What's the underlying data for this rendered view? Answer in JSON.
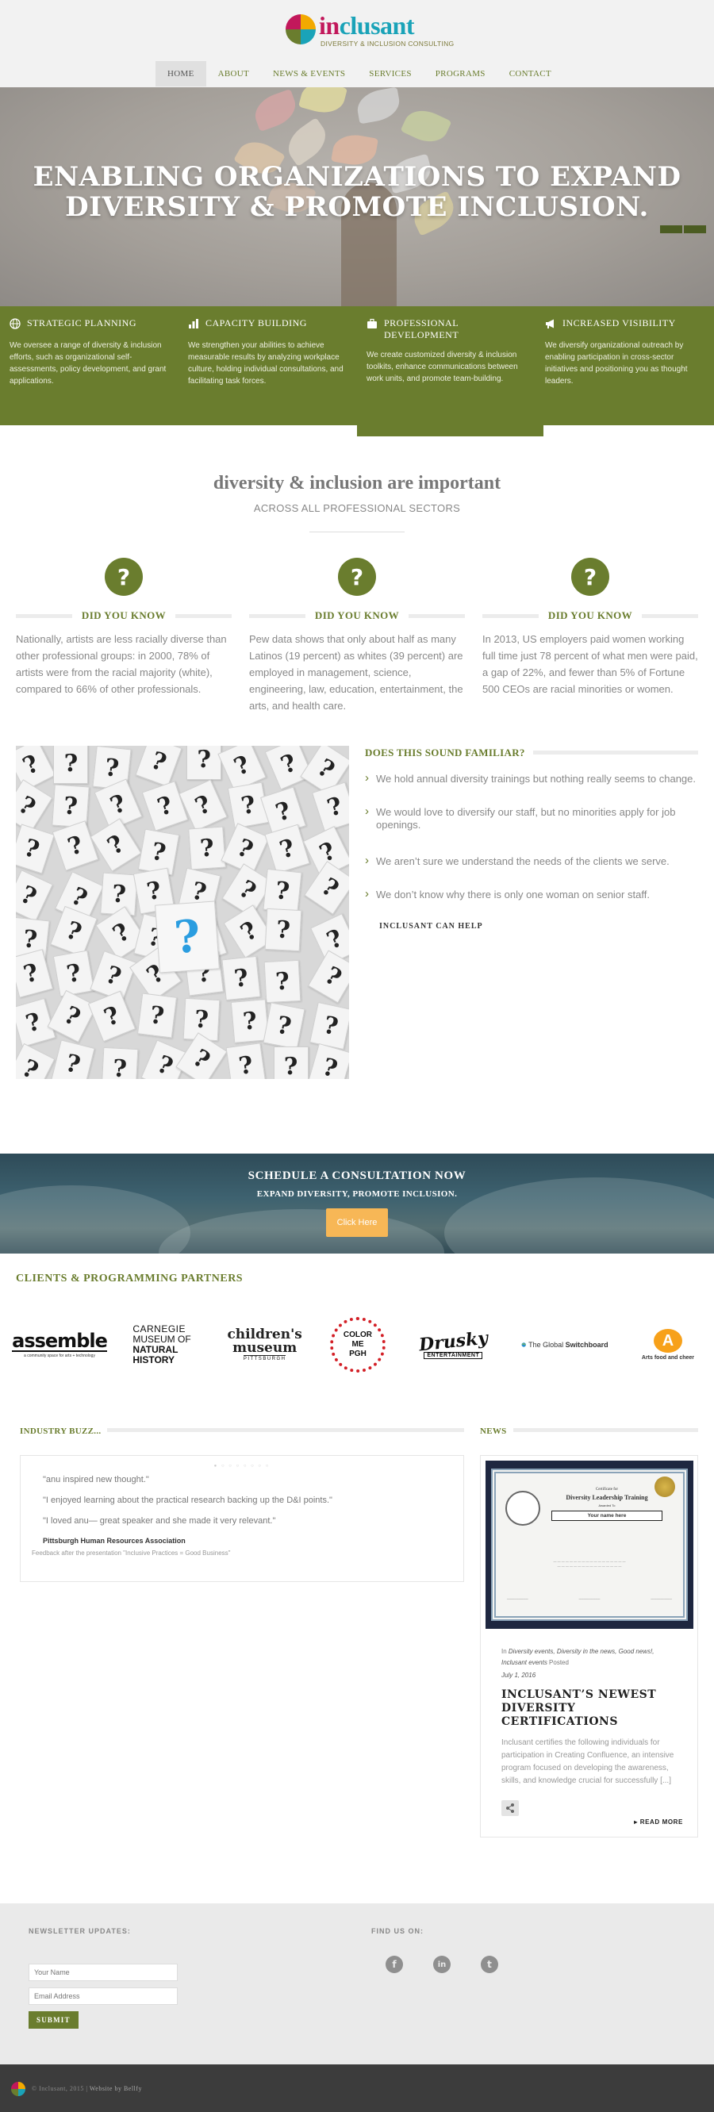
{
  "brand": {
    "name_part1": "in",
    "name_part2": "clusant",
    "tagline": "DIVERSITY & INCLUSION CONSULTING"
  },
  "nav": {
    "items": [
      {
        "label": "HOME",
        "active": true
      },
      {
        "label": "ABOUT"
      },
      {
        "label": "NEWS & EVENTS"
      },
      {
        "label": "SERVICES"
      },
      {
        "label": "PROGRAMS"
      },
      {
        "label": "CONTACT"
      }
    ]
  },
  "hero": {
    "line1": "ENABLING ORGANIZATIONS TO EXPAND",
    "line2": "DIVERSITY & PROMOTE INCLUSION."
  },
  "features": [
    {
      "icon": "globe-icon",
      "title": "STRATEGIC PLANNING",
      "text": "We oversee a range of diversity & inclusion efforts, such as organizational self-assessments, policy development, and grant applications."
    },
    {
      "icon": "bar-chart-icon",
      "title": "CAPACITY BUILDING",
      "text": "We strengthen your abilities to achieve measurable results by analyzing workplace culture, holding individual consultations, and facilitating task forces."
    },
    {
      "icon": "briefcase-icon",
      "title": "PROFESSIONAL DEVELOPMENT",
      "text": "We create customized diversity & inclusion toolkits, enhance communications between work units, and promote team-building."
    },
    {
      "icon": "megaphone-icon",
      "title": "INCREASED VISIBILITY",
      "text": "We diversify organizational outreach by enabling participation in cross-sector initiatives and positioning you as thought leaders."
    }
  ],
  "diversity": {
    "title": "diversity & inclusion are important",
    "subtitle": "ACROSS ALL PROFESSIONAL SECTORS",
    "icon_glyph": "?",
    "facts": [
      {
        "heading": "DID YOU KNOW",
        "text": "Nationally, artists are less racially diverse than other professional groups: in 2000, 78% of artists were from the racial majority (white), compared to 66% of other professionals."
      },
      {
        "heading": "DID YOU KNOW",
        "text": "Pew data shows that only about half as many Latinos (19 percent) as whites (39 percent) are employed in management, science, engineering, law, education, entertainment, the arts, and health care."
      },
      {
        "heading": "DID YOU KNOW",
        "text": "In 2013, US employers paid women working full time just 78 percent of what men were paid, a gap of 22%, and fewer than 5% of Fortune 500 CEOs are racial minorities or women."
      }
    ]
  },
  "familiar": {
    "title": "DOES THIS SOUND FAMILIAR?",
    "items": [
      "We hold annual diversity trainings but nothing really seems to change.",
      "We would love to diversify our staff, but no minorities apply for job openings.",
      "We aren’t sure we understand the needs of the clients we serve.",
      "We don’t know why there is only one woman on senior staff."
    ],
    "cta": "INCLUSANT CAN HELP",
    "image_glyph": "?"
  },
  "consult": {
    "title": "SCHEDULE A CONSULTATION NOW",
    "subtitle": "EXPAND DIVERSITY, PROMOTE INCLUSION.",
    "button": "Click Here"
  },
  "clients": {
    "title": "CLIENTS & PROGRAMMING PARTNERS",
    "assemble": {
      "name": "assemble",
      "tag": "a community space for arts + technology"
    },
    "carnegie": {
      "l1": "CARNEGIE",
      "l2": "MUSEUM OF",
      "l3": "NATURAL",
      "l4": "HISTORY"
    },
    "childrens": {
      "l1": "children's",
      "l2": "museum",
      "l3": "PITTSBURGH"
    },
    "colorme": {
      "l1": "COLOR",
      "l2": "ME",
      "l3": "PGH"
    },
    "drusky": {
      "l1": "Drusky",
      "l2": "ENTERTAINMENT"
    },
    "switchboard": {
      "pre": "The Global ",
      "name": "Switchboard"
    },
    "artsfood": {
      "letter": "A",
      "tag": "Arts food and cheer"
    }
  },
  "buzz": {
    "title": "INDUSTRY BUZZ...",
    "quotes": [
      "\"anu inspired new thought.\"",
      "\"I enjoyed learning about the practical research backing up the D&I points.\"",
      "\"I loved anu— great speaker and she made it very relevant.\""
    ],
    "org": "Pittsburgh Human Resources Association",
    "note": "Feedback after the presentation \"Inclusive Practices = Good Business\""
  },
  "news": {
    "title": "NEWS",
    "cert": {
      "t1": "Certificate for",
      "t2": "Diversity Leadership Training",
      "t3": "Awarded To",
      "name": "Your name here"
    },
    "meta_in": "In",
    "meta_cats": "Diversity events, Diversity in the news, Good news!, Inclusant events",
    "meta_posted": "Posted",
    "date": "July 1, 2016",
    "headline": "INCLUSANT’S NEWEST DIVERSITY CERTIFICATIONS",
    "excerpt": "Inclusant certifies the following individuals for participation in Creating Confluence, an intensive program focused on developing the awareness, skills, and knowledge crucial for successfully [...]",
    "read_more": "READ MORE"
  },
  "footer": {
    "newsletter_title": "NEWSLETTER UPDATES:",
    "name_placeholder": "Your Name",
    "email_placeholder": "Email Address",
    "submit": "SUBMIT",
    "find_title": "FIND US ON:",
    "socials": [
      {
        "icon": "facebook-icon",
        "glyph": "f"
      },
      {
        "icon": "linkedin-icon",
        "glyph": "in"
      },
      {
        "icon": "twitter-icon",
        "glyph": "t"
      }
    ],
    "copyright": "© Inclusant, 2015 |",
    "credit": "Website by Bellfy"
  },
  "colors": {
    "accent": "#6a7d2e",
    "cta": "#f7b756",
    "question_blue": "#2a9de0"
  }
}
